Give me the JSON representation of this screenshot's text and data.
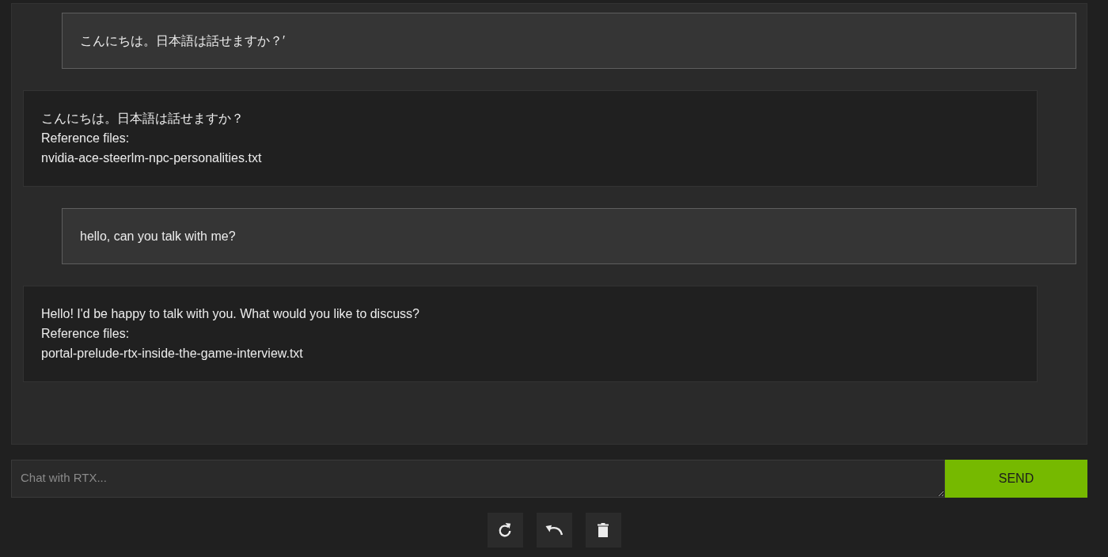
{
  "messages": [
    {
      "kind": "user",
      "text": "こんにちは。日本語は話せますか？′"
    },
    {
      "kind": "assistant",
      "text": "こんにちは。日本語は話せますか？",
      "reference_label": "Reference files:",
      "reference_file": "nvidia-ace-steerlm-npc-personalities.txt"
    },
    {
      "kind": "user",
      "text": "hello, can you talk with me?"
    },
    {
      "kind": "assistant",
      "text": "Hello! I'd be happy to talk with you. What would you like to discuss?",
      "reference_label": "Reference files:",
      "reference_file": "portal-prelude-rtx-inside-the-game-interview.txt"
    }
  ],
  "composer": {
    "placeholder": "Chat with RTX..."
  },
  "send_button": {
    "label": "SEND"
  },
  "actions": [
    {
      "kind": "regenerate"
    },
    {
      "kind": "undo"
    },
    {
      "kind": "clear"
    }
  ]
}
